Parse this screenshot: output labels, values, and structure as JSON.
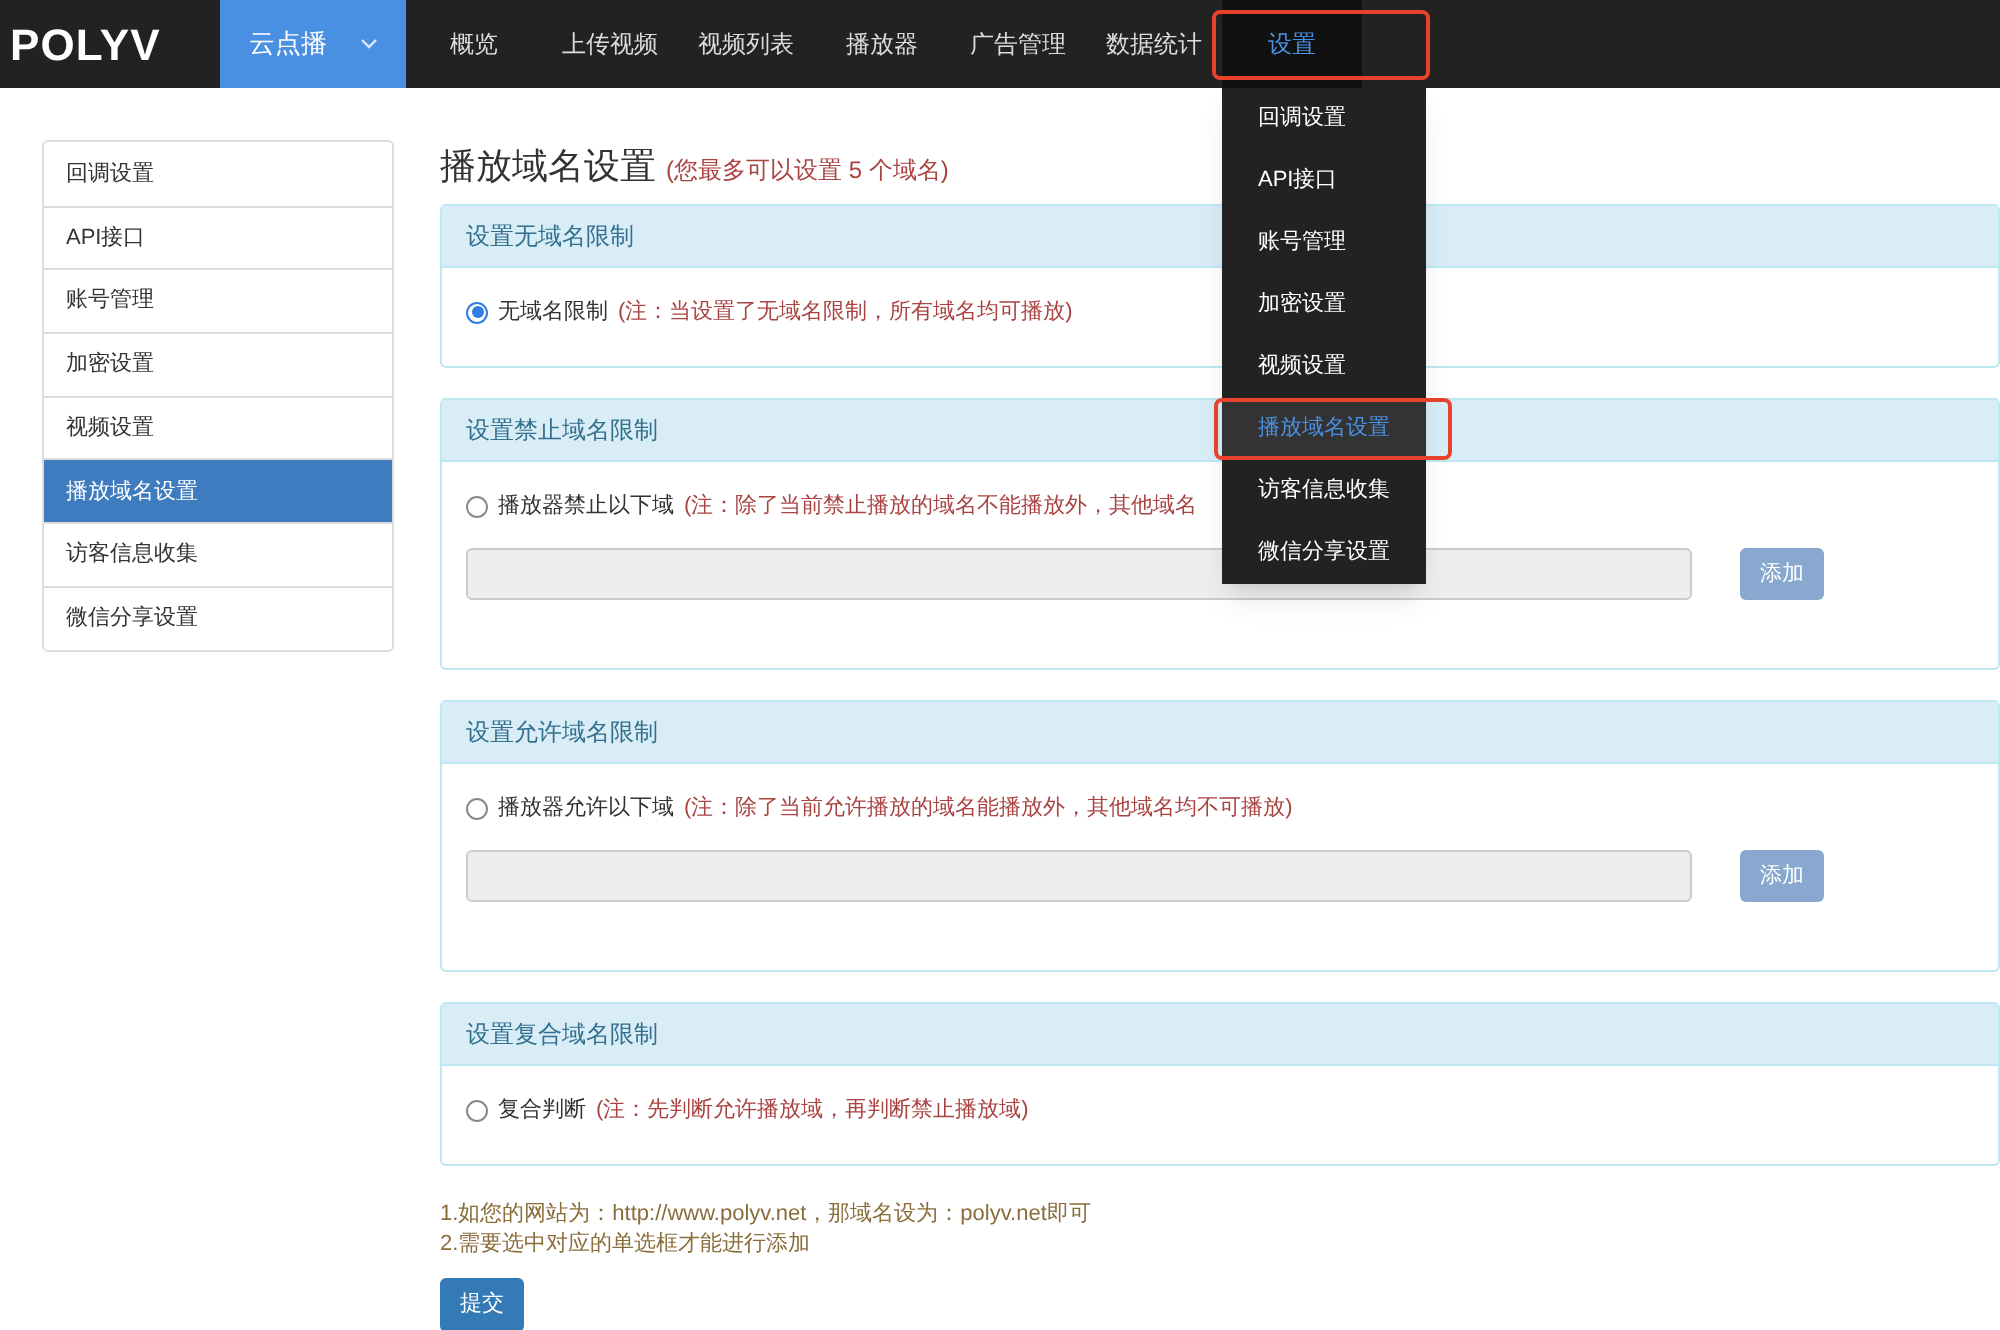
{
  "nav": {
    "logo": "POLYV",
    "items": [
      {
        "label": "云点播",
        "kind": "product",
        "selected": false
      },
      {
        "label": "概览",
        "kind": "link",
        "selected": false
      },
      {
        "label": "上传视频",
        "kind": "link",
        "selected": false
      },
      {
        "label": "视频列表",
        "kind": "link",
        "selected": false
      },
      {
        "label": "播放器",
        "kind": "link",
        "selected": false
      },
      {
        "label": "广告管理",
        "kind": "link",
        "selected": false
      },
      {
        "label": "数据统计",
        "kind": "link",
        "selected": false
      },
      {
        "label": "设置",
        "kind": "link",
        "selected": true
      }
    ],
    "dropdown": [
      {
        "label": "回调设置",
        "selected": false
      },
      {
        "label": "API接口",
        "selected": false
      },
      {
        "label": "账号管理",
        "selected": false
      },
      {
        "label": "加密设置",
        "selected": false
      },
      {
        "label": "视频设置",
        "selected": false
      },
      {
        "label": "播放域名设置",
        "selected": true
      },
      {
        "label": "访客信息收集",
        "selected": false
      },
      {
        "label": "微信分享设置",
        "selected": false
      }
    ]
  },
  "sidebar": {
    "items": [
      {
        "label": "回调设置",
        "selected": false
      },
      {
        "label": "API接口",
        "selected": false
      },
      {
        "label": "账号管理",
        "selected": false
      },
      {
        "label": "加密设置",
        "selected": false
      },
      {
        "label": "视频设置",
        "selected": false
      },
      {
        "label": "播放域名设置",
        "selected": true
      },
      {
        "label": "访客信息收集",
        "selected": false
      },
      {
        "label": "微信分享设置",
        "selected": false
      }
    ]
  },
  "page": {
    "title": "播放域名设置",
    "subtitle": "(您最多可以设置 5 个域名)"
  },
  "sections": [
    {
      "title": "设置无域名限制",
      "option": {
        "label": "无域名限制",
        "note": "(注：当设置了无域名限制，所有域名均可播放)",
        "checked": true
      }
    },
    {
      "title": "设置禁止域名限制",
      "option": {
        "label": "播放器禁止以下域",
        "note": "(注：除了当前禁止播放的域名不能播放外，其他域名",
        "checked": false
      },
      "input": {
        "disabled": true
      },
      "button": {
        "label": "添加",
        "disabled": true
      }
    },
    {
      "title": "设置允许域名限制",
      "option": {
        "label": "播放器允许以下域",
        "note": "(注：除了当前允许播放的域名能播放外，其他域名均不可播放)",
        "checked": false
      },
      "input": {
        "disabled": true
      },
      "button": {
        "label": "添加",
        "disabled": true
      }
    },
    {
      "title": "设置复合域名限制",
      "option": {
        "label": "复合判断",
        "note": "(注：先判断允许播放域，再判断禁止播放域)",
        "checked": false
      }
    }
  ],
  "hints": [
    "1.如您的网站为：http://www.polyv.net，那域名设为：polyv.net即可",
    "2.需要选中对应的单选框才能进行添加"
  ],
  "submit": "提交"
}
